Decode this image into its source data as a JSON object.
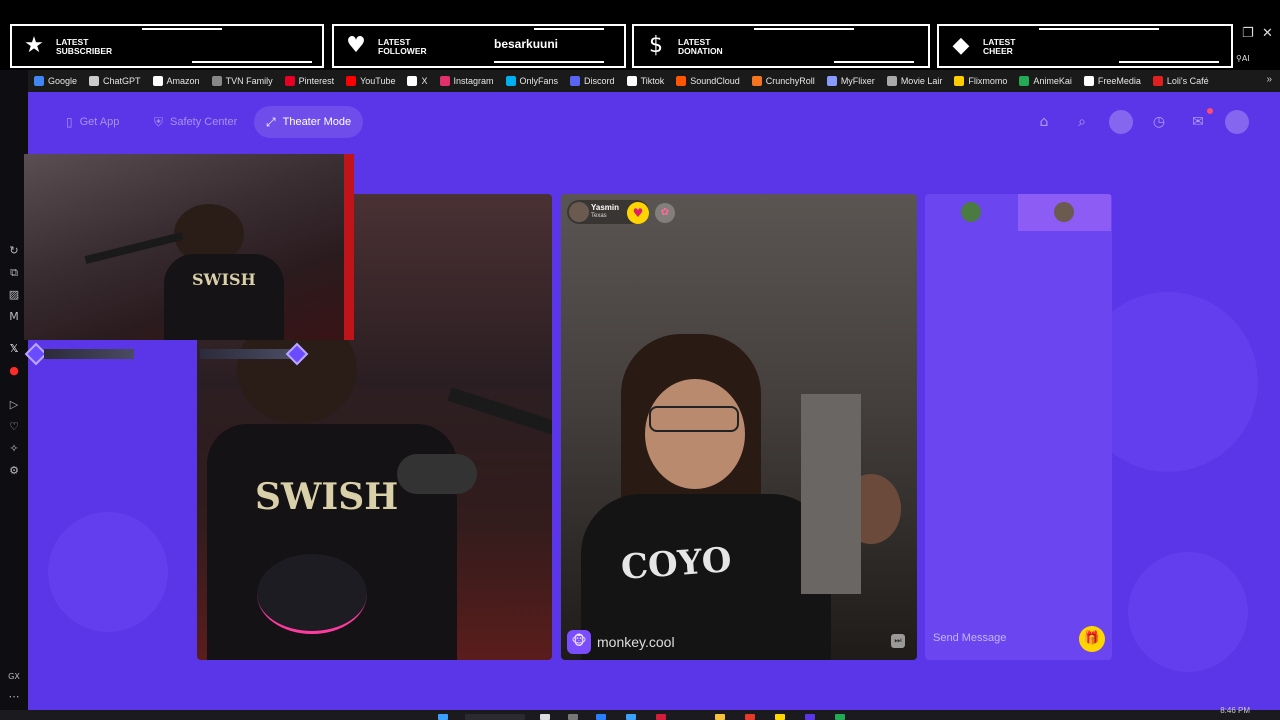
{
  "alerts": [
    {
      "label_1": "LATEST",
      "label_2": "SUBSCRIBER",
      "icon": "star-icon",
      "value": ""
    },
    {
      "label_1": "LATEST",
      "label_2": "FOLLOWER",
      "icon": "heart-icon",
      "value": "besarkuuni"
    },
    {
      "label_1": "LATEST",
      "label_2": "DONATION",
      "icon": "dollar-icon",
      "value": ""
    },
    {
      "label_1": "LATEST",
      "label_2": "CHEER",
      "icon": "diamond-icon",
      "value": ""
    }
  ],
  "bookmarks": [
    {
      "label": "Google",
      "color": "#4285f4"
    },
    {
      "label": "ChatGPT",
      "color": "#cccccc"
    },
    {
      "label": "Amazon",
      "color": "#ffffff"
    },
    {
      "label": "TVN Family",
      "color": "#888888"
    },
    {
      "label": "Pinterest",
      "color": "#e60023"
    },
    {
      "label": "YouTube",
      "color": "#ff0000"
    },
    {
      "label": "X",
      "color": "#ffffff"
    },
    {
      "label": "Instagram",
      "color": "#e1306c"
    },
    {
      "label": "OnlyFans",
      "color": "#00aff0"
    },
    {
      "label": "Discord",
      "color": "#5865f2"
    },
    {
      "label": "Tiktok",
      "color": "#ffffff"
    },
    {
      "label": "SoundCloud",
      "color": "#ff5500"
    },
    {
      "label": "CrunchyRoll",
      "color": "#f47521"
    },
    {
      "label": "MyFlixer",
      "color": "#8899ff"
    },
    {
      "label": "Movie Lair",
      "color": "#aaaaaa"
    },
    {
      "label": "Flixmomo",
      "color": "#ffcc00"
    },
    {
      "label": "AnimeKai",
      "color": "#22aa55"
    },
    {
      "label": "FreeMedia",
      "color": "#ffffff"
    },
    {
      "label": "Loli's Café",
      "color": "#e02020"
    }
  ],
  "top_nav": {
    "get_app": "Get App",
    "safety_center": "Safety Center",
    "theater_mode": "Theater Mode"
  },
  "remote_user": {
    "name": "Yasmin",
    "location": "Texas"
  },
  "watermark": "monkey.cool",
  "chat": {
    "placeholder": "Send Message"
  },
  "taskbar": {
    "clock": "8:46 PM"
  },
  "browser": {
    "ai_label": "AI",
    "gx_label": "GX"
  },
  "colors": {
    "app_bg": "#5b35e8",
    "chat_bg": "#6a45f0",
    "accent_yellow": "#ffd400"
  }
}
